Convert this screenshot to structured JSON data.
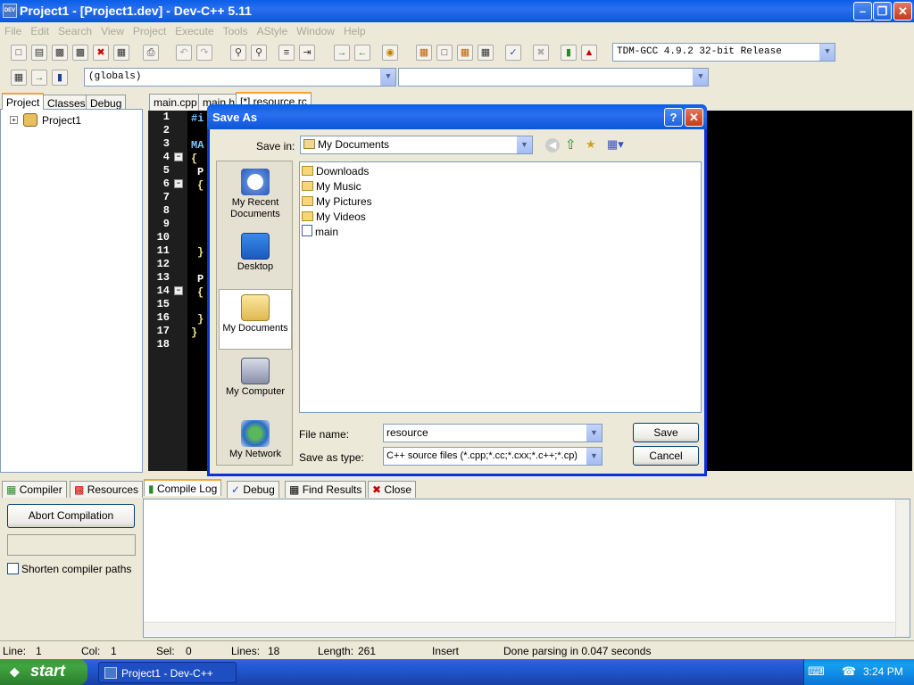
{
  "window": {
    "title": "Project1 - [Project1.dev] - Dev-C++ 5.11",
    "app_icon": "DEV"
  },
  "menu": [
    "File",
    "Edit",
    "Search",
    "View",
    "Project",
    "Execute",
    "Tools",
    "AStyle",
    "Window",
    "Help"
  ],
  "toolbar": {
    "compiler": "TDM-GCC 4.9.2 32-bit Release",
    "scope": "(globals)",
    "symbol": ""
  },
  "left_tabs": [
    "Project",
    "Classes",
    "Debug"
  ],
  "project_tree": {
    "root": "Project1"
  },
  "editor_tabs": [
    "main.cpp",
    "main.h",
    "[*] resource.rc"
  ],
  "editor": {
    "line_numbers": [
      "1",
      "2",
      "3",
      "4",
      "5",
      "6",
      "7",
      "8",
      "9",
      "10",
      "11",
      "12",
      "13",
      "14",
      "15",
      "16",
      "17",
      "18"
    ],
    "visible_code": [
      "#i",
      "",
      "MA",
      "{",
      "P",
      "{",
      "",
      "",
      "",
      "",
      "}",
      "",
      "P",
      "{",
      "",
      "}",
      "}",
      ""
    ]
  },
  "bottom_tabs": [
    "Compiler",
    "Resources",
    "Compile Log",
    "Debug",
    "Find Results",
    "Close"
  ],
  "compile_panel": {
    "abort_label": "Abort Compilation",
    "shorten_label": "Shorten compiler paths",
    "shorten_checked": false
  },
  "status": {
    "line_label": "Line:",
    "line": "1",
    "col_label": "Col:",
    "col": "1",
    "sel_label": "Sel:",
    "sel": "0",
    "lines_label": "Lines:",
    "lines": "18",
    "length_label": "Length:",
    "length": "261",
    "mode": "Insert",
    "message": "Done parsing in 0.047 seconds"
  },
  "taskbar": {
    "start_label": "start",
    "task_label": "Project1 - Dev-C++",
    "clock": "3:24 PM"
  },
  "dialog": {
    "title": "Save As",
    "save_in_label": "Save in:",
    "save_in_value": "My Documents",
    "places": [
      "My Recent Documents",
      "Desktop",
      "My Documents",
      "My Computer",
      "My Network"
    ],
    "files": [
      {
        "name": "Downloads",
        "icon": "folder-icon"
      },
      {
        "name": "My Music",
        "icon": "music-folder-icon"
      },
      {
        "name": "My Pictures",
        "icon": "pictures-folder-icon"
      },
      {
        "name": "My Videos",
        "icon": "videos-folder-icon"
      },
      {
        "name": "main",
        "icon": "cpp-file-icon"
      }
    ],
    "file_name_label": "File name:",
    "file_name_value": "resource",
    "save_as_type_label": "Save as type:",
    "save_as_type_value": "C++ source files (*.cpp;*.cc;*.cxx;*.c++;*.cp)",
    "save_button": "Save",
    "cancel_button": "Cancel"
  }
}
